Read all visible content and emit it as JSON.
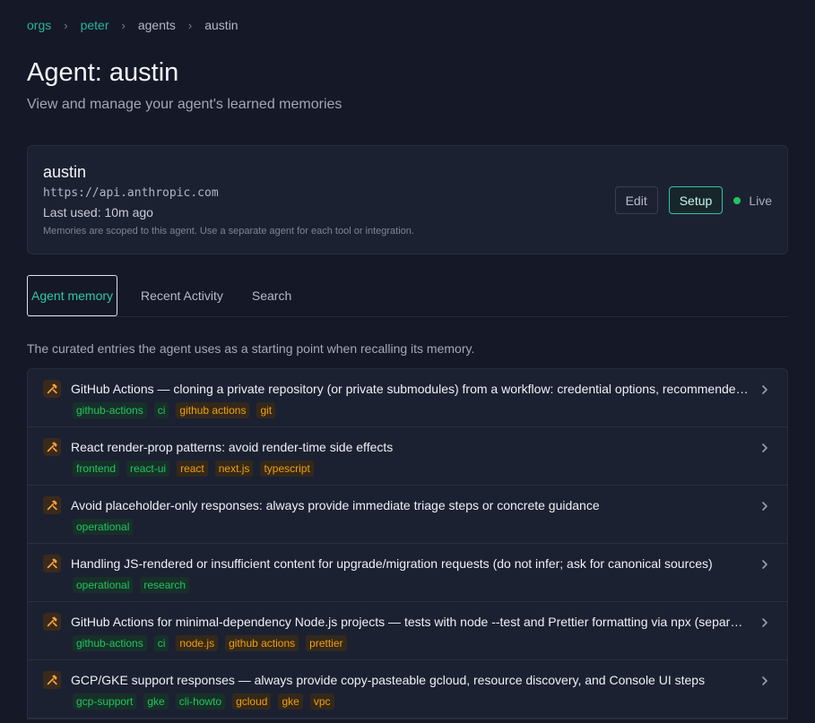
{
  "breadcrumb": [
    {
      "label": "orgs",
      "link": true
    },
    {
      "label": "peter",
      "link": true
    },
    {
      "label": "agents",
      "link": false
    },
    {
      "label": "austin",
      "link": false
    }
  ],
  "page": {
    "title": "Agent: austin",
    "subtitle": "View and manage your agent's learned memories"
  },
  "agent": {
    "name": "austin",
    "url": "https://api.anthropic.com",
    "last_used": "Last used: 10m ago",
    "note": "Memories are scoped to this agent. Use a separate agent for each tool or integration.",
    "edit_label": "Edit",
    "setup_label": "Setup",
    "status_label": "Live",
    "status_color": "#22c55e"
  },
  "tabs": [
    {
      "label": "Agent memory",
      "active": true
    },
    {
      "label": "Recent Activity",
      "active": false
    },
    {
      "label": "Search",
      "active": false
    }
  ],
  "tab_description": "The curated entries the agent uses as a starting point when recalling its memory.",
  "colors": {
    "accent": "#2fc3a4",
    "tag_green": "#22c55e",
    "tag_orange": "#f59e0b"
  },
  "memories": [
    {
      "icon": "hammer-wrench-icon",
      "title": "GitHub Actions — cloning a private repository (or private submodules) from a workflow: credential options, recommended defaults",
      "tags": [
        {
          "label": "github-actions",
          "color": "green"
        },
        {
          "label": "ci",
          "color": "green"
        },
        {
          "label": "github actions",
          "color": "orange"
        },
        {
          "label": "git",
          "color": "orange"
        }
      ]
    },
    {
      "icon": "hammer-wrench-icon",
      "title": "React render-prop patterns: avoid render-time side effects",
      "tags": [
        {
          "label": "frontend",
          "color": "green"
        },
        {
          "label": "react-ui",
          "color": "green"
        },
        {
          "label": "react",
          "color": "orange"
        },
        {
          "label": "next.js",
          "color": "orange"
        },
        {
          "label": "typescript",
          "color": "orange"
        }
      ]
    },
    {
      "icon": "hammer-wrench-icon",
      "title": "Avoid placeholder-only responses: always provide immediate triage steps or concrete guidance",
      "tags": [
        {
          "label": "operational",
          "color": "green"
        }
      ]
    },
    {
      "icon": "hammer-wrench-icon",
      "title": "Handling JS-rendered or insufficient content for upgrade/migration requests (do not infer; ask for canonical sources)",
      "tags": [
        {
          "label": "operational",
          "color": "green"
        },
        {
          "label": "research",
          "color": "green"
        }
      ]
    },
    {
      "icon": "hammer-wrench-icon",
      "title": "GitHub Actions for minimal-dependency Node.js projects — tests with node --test and Prettier formatting via npx (separate workflows)",
      "tags": [
        {
          "label": "github-actions",
          "color": "green"
        },
        {
          "label": "ci",
          "color": "green"
        },
        {
          "label": "node.js",
          "color": "orange"
        },
        {
          "label": "github actions",
          "color": "orange"
        },
        {
          "label": "prettier",
          "color": "orange"
        }
      ]
    },
    {
      "icon": "hammer-wrench-icon",
      "title": "GCP/GKE support responses — always provide copy-pasteable gcloud, resource discovery, and Console UI steps",
      "tags": [
        {
          "label": "gcp-support",
          "color": "green"
        },
        {
          "label": "gke",
          "color": "green"
        },
        {
          "label": "cli-howto",
          "color": "green"
        },
        {
          "label": "gcloud",
          "color": "orange"
        },
        {
          "label": "gke",
          "color": "orange"
        },
        {
          "label": "vpc",
          "color": "orange"
        }
      ]
    }
  ]
}
